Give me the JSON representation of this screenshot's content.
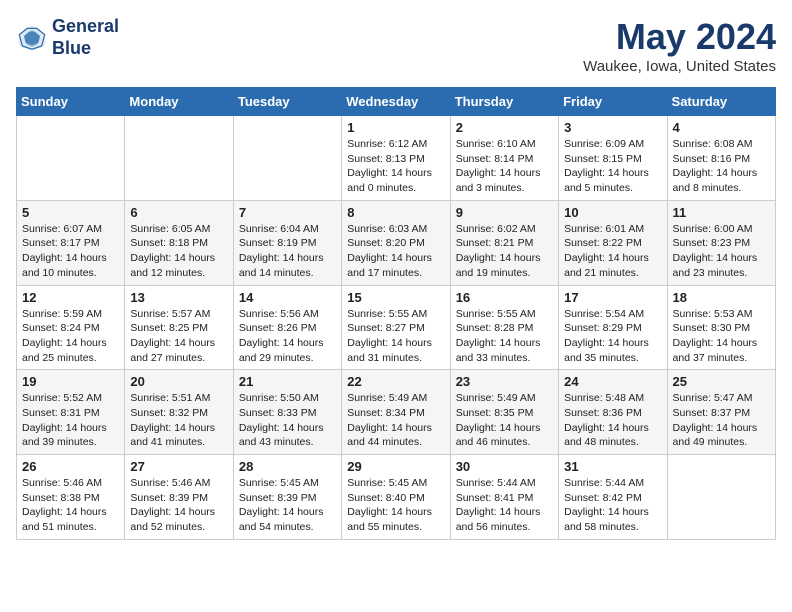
{
  "header": {
    "logo_line1": "General",
    "logo_line2": "Blue",
    "month": "May 2024",
    "location": "Waukee, Iowa, United States"
  },
  "days_of_week": [
    "Sunday",
    "Monday",
    "Tuesday",
    "Wednesday",
    "Thursday",
    "Friday",
    "Saturday"
  ],
  "weeks": [
    [
      {
        "day": "",
        "info": ""
      },
      {
        "day": "",
        "info": ""
      },
      {
        "day": "",
        "info": ""
      },
      {
        "day": "1",
        "info": "Sunrise: 6:12 AM\nSunset: 8:13 PM\nDaylight: 14 hours\nand 0 minutes."
      },
      {
        "day": "2",
        "info": "Sunrise: 6:10 AM\nSunset: 8:14 PM\nDaylight: 14 hours\nand 3 minutes."
      },
      {
        "day": "3",
        "info": "Sunrise: 6:09 AM\nSunset: 8:15 PM\nDaylight: 14 hours\nand 5 minutes."
      },
      {
        "day": "4",
        "info": "Sunrise: 6:08 AM\nSunset: 8:16 PM\nDaylight: 14 hours\nand 8 minutes."
      }
    ],
    [
      {
        "day": "5",
        "info": "Sunrise: 6:07 AM\nSunset: 8:17 PM\nDaylight: 14 hours\nand 10 minutes."
      },
      {
        "day": "6",
        "info": "Sunrise: 6:05 AM\nSunset: 8:18 PM\nDaylight: 14 hours\nand 12 minutes."
      },
      {
        "day": "7",
        "info": "Sunrise: 6:04 AM\nSunset: 8:19 PM\nDaylight: 14 hours\nand 14 minutes."
      },
      {
        "day": "8",
        "info": "Sunrise: 6:03 AM\nSunset: 8:20 PM\nDaylight: 14 hours\nand 17 minutes."
      },
      {
        "day": "9",
        "info": "Sunrise: 6:02 AM\nSunset: 8:21 PM\nDaylight: 14 hours\nand 19 minutes."
      },
      {
        "day": "10",
        "info": "Sunrise: 6:01 AM\nSunset: 8:22 PM\nDaylight: 14 hours\nand 21 minutes."
      },
      {
        "day": "11",
        "info": "Sunrise: 6:00 AM\nSunset: 8:23 PM\nDaylight: 14 hours\nand 23 minutes."
      }
    ],
    [
      {
        "day": "12",
        "info": "Sunrise: 5:59 AM\nSunset: 8:24 PM\nDaylight: 14 hours\nand 25 minutes."
      },
      {
        "day": "13",
        "info": "Sunrise: 5:57 AM\nSunset: 8:25 PM\nDaylight: 14 hours\nand 27 minutes."
      },
      {
        "day": "14",
        "info": "Sunrise: 5:56 AM\nSunset: 8:26 PM\nDaylight: 14 hours\nand 29 minutes."
      },
      {
        "day": "15",
        "info": "Sunrise: 5:55 AM\nSunset: 8:27 PM\nDaylight: 14 hours\nand 31 minutes."
      },
      {
        "day": "16",
        "info": "Sunrise: 5:55 AM\nSunset: 8:28 PM\nDaylight: 14 hours\nand 33 minutes."
      },
      {
        "day": "17",
        "info": "Sunrise: 5:54 AM\nSunset: 8:29 PM\nDaylight: 14 hours\nand 35 minutes."
      },
      {
        "day": "18",
        "info": "Sunrise: 5:53 AM\nSunset: 8:30 PM\nDaylight: 14 hours\nand 37 minutes."
      }
    ],
    [
      {
        "day": "19",
        "info": "Sunrise: 5:52 AM\nSunset: 8:31 PM\nDaylight: 14 hours\nand 39 minutes."
      },
      {
        "day": "20",
        "info": "Sunrise: 5:51 AM\nSunset: 8:32 PM\nDaylight: 14 hours\nand 41 minutes."
      },
      {
        "day": "21",
        "info": "Sunrise: 5:50 AM\nSunset: 8:33 PM\nDaylight: 14 hours\nand 43 minutes."
      },
      {
        "day": "22",
        "info": "Sunrise: 5:49 AM\nSunset: 8:34 PM\nDaylight: 14 hours\nand 44 minutes."
      },
      {
        "day": "23",
        "info": "Sunrise: 5:49 AM\nSunset: 8:35 PM\nDaylight: 14 hours\nand 46 minutes."
      },
      {
        "day": "24",
        "info": "Sunrise: 5:48 AM\nSunset: 8:36 PM\nDaylight: 14 hours\nand 48 minutes."
      },
      {
        "day": "25",
        "info": "Sunrise: 5:47 AM\nSunset: 8:37 PM\nDaylight: 14 hours\nand 49 minutes."
      }
    ],
    [
      {
        "day": "26",
        "info": "Sunrise: 5:46 AM\nSunset: 8:38 PM\nDaylight: 14 hours\nand 51 minutes."
      },
      {
        "day": "27",
        "info": "Sunrise: 5:46 AM\nSunset: 8:39 PM\nDaylight: 14 hours\nand 52 minutes."
      },
      {
        "day": "28",
        "info": "Sunrise: 5:45 AM\nSunset: 8:39 PM\nDaylight: 14 hours\nand 54 minutes."
      },
      {
        "day": "29",
        "info": "Sunrise: 5:45 AM\nSunset: 8:40 PM\nDaylight: 14 hours\nand 55 minutes."
      },
      {
        "day": "30",
        "info": "Sunrise: 5:44 AM\nSunset: 8:41 PM\nDaylight: 14 hours\nand 56 minutes."
      },
      {
        "day": "31",
        "info": "Sunrise: 5:44 AM\nSunset: 8:42 PM\nDaylight: 14 hours\nand 58 minutes."
      },
      {
        "day": "",
        "info": ""
      }
    ]
  ]
}
